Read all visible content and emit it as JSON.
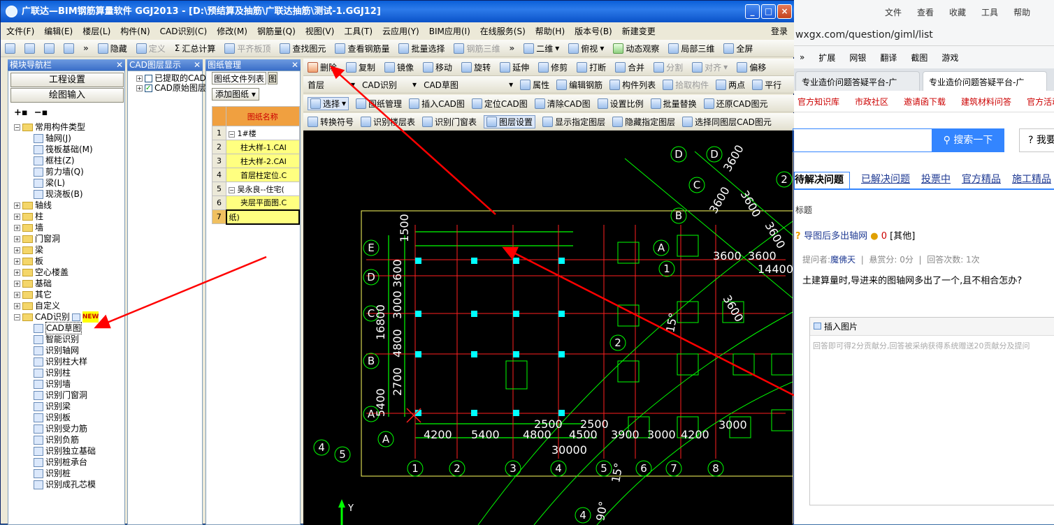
{
  "app": {
    "title": "广联达—BIM钢筋算量软件 GGJ2013 - [D:\\预结算及抽筋\\广联达抽筋\\测试-1.GGJ12]",
    "win_buttons": [
      "_",
      "□",
      "×"
    ],
    "menu": [
      "文件(F)",
      "编辑(E)",
      "楼层(L)",
      "构件(N)",
      "CAD识别(C)",
      "修改(M)",
      "钢筋量(Q)",
      "视图(V)",
      "工具(T)",
      "云应用(Y)",
      "BIM应用(I)",
      "在线服务(S)",
      "帮助(H)",
      "版本号(B)",
      "新建变更"
    ],
    "login": "登录",
    "toolbar1": [
      "隐藏",
      "定义",
      "汇总计算",
      "平齐板顶",
      "查找图元",
      "查看钢筋量",
      "批量选择",
      "钢筋三维",
      "二维",
      "俯视",
      "动态观察",
      "局部三维",
      "全屏"
    ],
    "toolbar2": [
      "删除",
      "复制",
      "镜像",
      "移动",
      "旋转",
      "延伸",
      "修剪",
      "打断",
      "合并",
      "分割",
      "对齐",
      "偏移"
    ],
    "toolbar3": {
      "floor": "首层",
      "cad": "CAD识别",
      "sketch": "CAD草图",
      "items": [
        "属性",
        "编辑钢筋",
        "构件列表",
        "拾取构件",
        "两点",
        "平行"
      ]
    },
    "toolbar4": [
      "选择",
      "图纸管理",
      "插入CAD图",
      "定位CAD图",
      "清除CAD图",
      "设置比例",
      "批量替换",
      "还原CAD图元"
    ],
    "toolbar5": [
      "转换符号",
      "识别楼层表",
      "识别门窗表",
      "图层设置",
      "显示指定图层",
      "隐藏指定图层",
      "选择同图层CAD图元"
    ],
    "chevron": "»"
  },
  "left_panel": {
    "header": "模块导航栏",
    "pin": "✕",
    "btn_project": "工程设置",
    "btn_draw": "绘图输入",
    "tree_root": "常用构件类型",
    "common": [
      "轴网(J)",
      "筏板基础(M)",
      "框柱(Z)",
      "剪力墙(Q)",
      "梁(L)",
      "现浇板(B)"
    ],
    "groups": [
      "轴线",
      "柱",
      "墙",
      "门窗洞",
      "梁",
      "板",
      "空心楼盖",
      "基础",
      "其它",
      "自定义"
    ],
    "cad_group": "CAD识别",
    "new_badge": "NEW",
    "cad_items": [
      "CAD草图",
      "智能识别",
      "识别轴网",
      "识别柱大样",
      "识别柱",
      "识别墙",
      "识别门窗洞",
      "识别梁",
      "识别板",
      "识别受力筋",
      "识别负筋",
      "识别独立基础",
      "识别桩承台",
      "识别桩",
      "识别成孔芯模"
    ]
  },
  "cad_panel": {
    "header": "CAD图层显示",
    "items": [
      "已提取的CAD",
      "CAD原始图层"
    ]
  },
  "drawing_panel": {
    "header": "图纸管理",
    "tabs": [
      "图纸文件列表",
      "图"
    ],
    "add_btn": "添加图纸",
    "col_header": "图纸名称",
    "rows": [
      {
        "n": "1",
        "text": "1#楼",
        "pm": "−"
      },
      {
        "n": "2",
        "text": "柱大样-1.CAI"
      },
      {
        "n": "3",
        "text": "柱大样-2.CAI"
      },
      {
        "n": "4",
        "text": "首层柱定位.C"
      },
      {
        "n": "5",
        "text": "吴永良--住宅(",
        "pm": "−"
      },
      {
        "n": "6",
        "text": "夹层平面图.C"
      },
      {
        "n": "7",
        "text": "纸)"
      }
    ]
  },
  "canvas": {
    "dims": [
      "1500",
      "3600",
      "3000",
      "16800",
      "4800",
      "2700",
      "5400",
      "3600",
      "3600",
      "3600",
      "14400",
      "4200",
      "5400",
      "4800",
      "4500",
      "2500",
      "2500",
      "3900",
      "3000",
      "4200",
      "3000",
      "30000",
      "3600",
      "3600",
      "3600",
      "3600",
      "3600"
    ],
    "axis_bubbles_left": [
      "E",
      "D",
      "C",
      "B",
      "A"
    ],
    "axis_bubbles_bottom": [
      "1",
      "2",
      "3",
      "4",
      "5",
      "6",
      "7",
      "8"
    ],
    "axis_bubbles_misc": [
      "D",
      "D",
      "C",
      "B",
      "A",
      "A",
      "4",
      "5",
      "1",
      "2",
      "3",
      "2"
    ],
    "angles": [
      "15°",
      "15°",
      "90°"
    ],
    "axis_y": "Y",
    "colors": {
      "line_green": "#00ff00",
      "line_red": "#ff2020",
      "line_yellow": "#ffff60",
      "cyan": "#00ffff",
      "bg": "#000000"
    }
  },
  "browser": {
    "menu": [
      "文件",
      "查看",
      "收藏",
      "工具",
      "帮助"
    ],
    "url": "wxgx.com/question/giml/list",
    "tools": [
      "扩展",
      "网银",
      "翻译",
      "截图",
      "游戏"
    ],
    "tabs": [
      "专业造价问题答疑平台-广",
      "专业造价问题答疑平台-广"
    ],
    "links": [
      "官方知识库",
      "市政社区",
      "邀请函下载",
      "建筑材料问答",
      "官方活动"
    ],
    "search_btn": "搜索一下",
    "help_btn": "我要",
    "qtabs": [
      "待解决问题",
      "已解决问题",
      "投票中",
      "官方精品",
      "施工精品"
    ],
    "label_title": "标题",
    "question_title": "导图后多出轴网",
    "coins": "0",
    "category": "[其他]",
    "asker_label": "提问者:",
    "asker": "魔佛天",
    "reward": "悬赏分: 0分",
    "answers": "回答次数: 1次",
    "body": "土建算量时,导进来的图轴网多出了一个,且不相合怎办?",
    "insert_image": "插入图片",
    "answer_placeholder": "回答即可得2分贡献分,回答被采纳获得系统赠送20贡献分及提问"
  }
}
